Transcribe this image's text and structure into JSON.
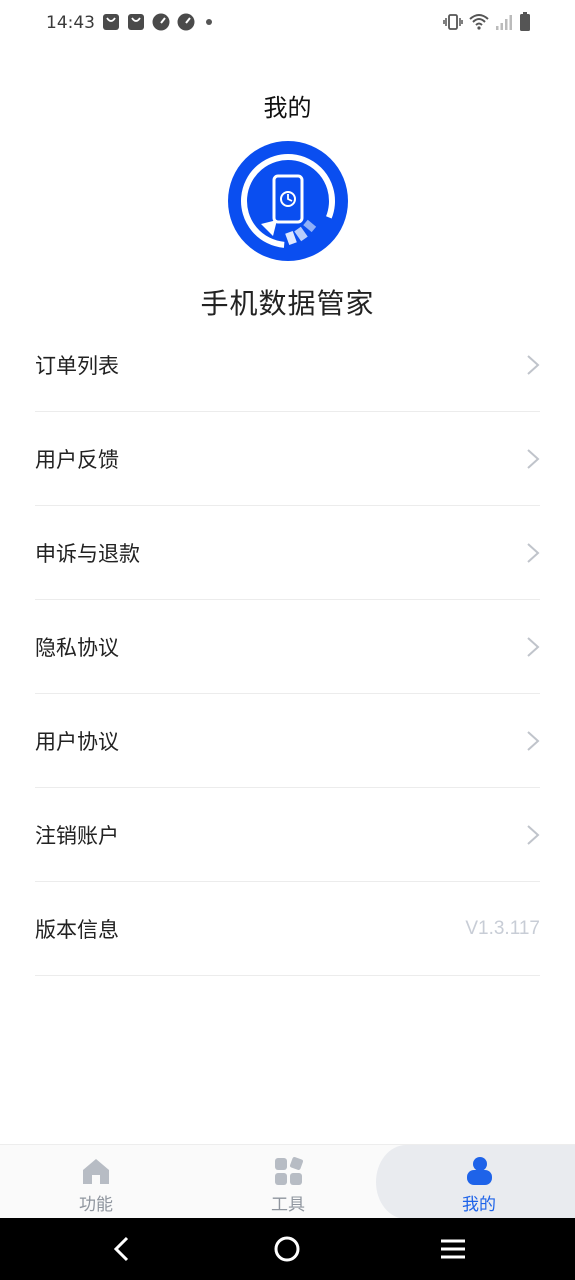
{
  "status_bar": {
    "time": "14:43",
    "left_icons": [
      "shopping-bag-icon",
      "shopping-bag-icon",
      "speedometer-icon",
      "speedometer-icon",
      "dot-icon"
    ],
    "right_icons": [
      "vibrate-icon",
      "wifi-icon",
      "signal-icon",
      "battery-icon"
    ]
  },
  "header": {
    "title": "我的",
    "app_name": "手机数据管家",
    "logo_icon": "phone-sync-logo-icon",
    "brand_color": "#0a4ef0"
  },
  "menu": {
    "items": [
      {
        "label": "订单列表",
        "icon": "chevron-right-icon"
      },
      {
        "label": "用户反馈",
        "icon": "chevron-right-icon"
      },
      {
        "label": "申诉与退款",
        "icon": "chevron-right-icon"
      },
      {
        "label": "隐私协议",
        "icon": "chevron-right-icon"
      },
      {
        "label": "用户协议",
        "icon": "chevron-right-icon"
      },
      {
        "label": "注销账户",
        "icon": "chevron-right-icon"
      }
    ],
    "version": {
      "label": "版本信息",
      "value": "V1.3.117"
    }
  },
  "bottom_nav": {
    "items": [
      {
        "label": "功能",
        "icon": "home-icon",
        "active": false
      },
      {
        "label": "工具",
        "icon": "grid-tools-icon",
        "active": false
      },
      {
        "label": "我的",
        "icon": "user-icon",
        "active": true
      }
    ],
    "active_color": "#1e63e9",
    "inactive_color": "#b7bcc4"
  },
  "system_nav": {
    "buttons": [
      "back-icon",
      "home-circle-icon",
      "menu-lines-icon"
    ]
  }
}
